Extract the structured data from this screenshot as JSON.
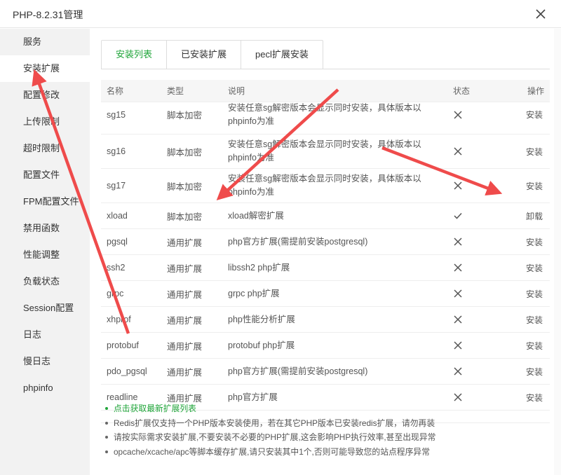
{
  "window": {
    "title": "PHP-8.2.31管理",
    "close_icon": "close-icon"
  },
  "sidebar": {
    "items": [
      {
        "label": "服务"
      },
      {
        "label": "安装扩展",
        "active": true
      },
      {
        "label": "配置修改"
      },
      {
        "label": "上传限制"
      },
      {
        "label": "超时限制"
      },
      {
        "label": "配置文件"
      },
      {
        "label": "FPM配置文件"
      },
      {
        "label": "禁用函数"
      },
      {
        "label": "性能调整"
      },
      {
        "label": "负载状态"
      },
      {
        "label": "Session配置"
      },
      {
        "label": "日志"
      },
      {
        "label": "慢日志"
      },
      {
        "label": "phpinfo"
      }
    ]
  },
  "tabs": [
    {
      "label": "安装列表",
      "active": true
    },
    {
      "label": "已安装扩展"
    },
    {
      "label": "pecl扩展安装"
    }
  ],
  "table": {
    "headers": {
      "name": "名称",
      "type": "类型",
      "desc": "说明",
      "status": "状态",
      "action": "操作"
    },
    "rows": [
      {
        "name": "sg15",
        "type": "脚本加密",
        "desc": "安装任意sg解密版本会显示同时安装，具体版本以phpinfo为准",
        "installed": false,
        "action": "安装",
        "height": 56
      },
      {
        "name": "sg16",
        "type": "脚本加密",
        "desc": "安装任意sg解密版本会显示同时安装，具体版本以phpinfo为准",
        "installed": false,
        "action": "安装",
        "height": 49
      },
      {
        "name": "sg17",
        "type": "脚本加密",
        "desc": "安装任意sg解密版本会显示同时安装，具体版本以phpinfo为准",
        "installed": false,
        "action": "安装",
        "height": 49
      },
      {
        "name": "xload",
        "type": "脚本加密",
        "desc": "xload解密扩展",
        "installed": true,
        "action": "卸载",
        "height": 37
      },
      {
        "name": "pgsql",
        "type": "通用扩展",
        "desc": "php官方扩展(需提前安装postgresql)",
        "installed": false,
        "action": "安装",
        "height": 37
      },
      {
        "name": "ssh2",
        "type": "通用扩展",
        "desc": "libssh2 php扩展",
        "installed": false,
        "action": "安装",
        "height": 37
      },
      {
        "name": "grpc",
        "type": "通用扩展",
        "desc": "grpc php扩展",
        "installed": false,
        "action": "安装",
        "height": 37
      },
      {
        "name": "xhprof",
        "type": "通用扩展",
        "desc": "php性能分析扩展",
        "installed": false,
        "action": "安装",
        "height": 37
      },
      {
        "name": "protobuf",
        "type": "通用扩展",
        "desc": "protobuf php扩展",
        "installed": false,
        "action": "安装",
        "height": 37
      },
      {
        "name": "pdo_pgsql",
        "type": "通用扩展",
        "desc": "php官方扩展(需提前安装postgresql)",
        "installed": false,
        "action": "安装",
        "height": 37
      },
      {
        "name": "readline",
        "type": "通用扩展",
        "desc": "php官方扩展",
        "installed": false,
        "action": "安装",
        "height": 37
      }
    ]
  },
  "notes": [
    {
      "text": "点击获取最新扩展列表",
      "link": true
    },
    {
      "text": "Redis扩展仅支持一个PHP版本安装使用，若在其它PHP版本已安装redis扩展，请勿再装"
    },
    {
      "text": "请按实际需求安装扩展,不要安装不必要的PHP扩展,这会影响PHP执行效率,甚至出现异常"
    },
    {
      "text": "opcache/xcache/apc等脚本缓存扩展,请只安装其中1个,否则可能导致您的站点程序异常"
    }
  ],
  "colors": {
    "accent": "#20a53a",
    "danger": "#d9534f",
    "annotation": "#ef4b4b"
  }
}
